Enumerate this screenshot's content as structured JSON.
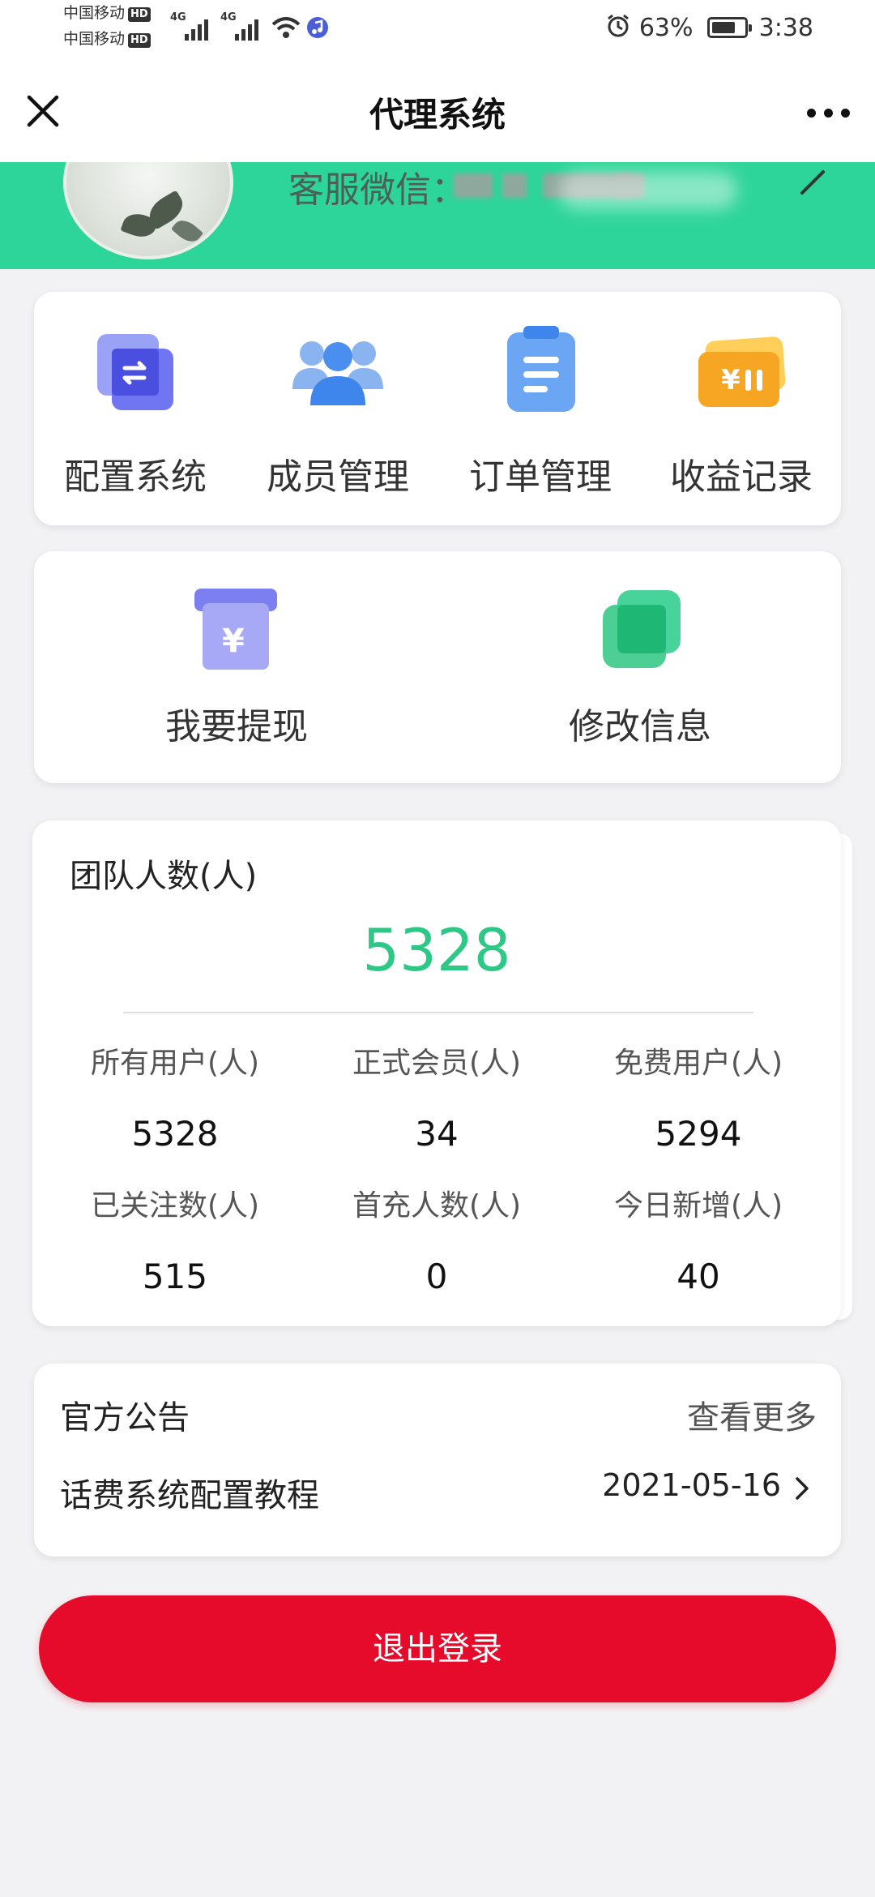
{
  "status_bar": {
    "carrier1": "中国移动",
    "carrier2": "中国移动",
    "hd": "HD",
    "net1": "4G",
    "net2": "4G",
    "battery": "63%",
    "time": "3:38"
  },
  "nav": {
    "title": "代理系统"
  },
  "header": {
    "customer_service": "客服微信："
  },
  "menu_primary": [
    {
      "label": "配置系统",
      "icon": "config-icon"
    },
    {
      "label": "成员管理",
      "icon": "members-icon"
    },
    {
      "label": "订单管理",
      "icon": "orders-icon"
    },
    {
      "label": "收益记录",
      "icon": "earnings-icon"
    }
  ],
  "menu_secondary": [
    {
      "label": "我要提现",
      "icon": "withdraw-icon"
    },
    {
      "label": "修改信息",
      "icon": "edit-info-icon"
    }
  ],
  "team": {
    "label": "团队人数(人)",
    "total": "5328",
    "stats": [
      {
        "label": "所有用户(人)",
        "value": "5328"
      },
      {
        "label": "正式会员(人)",
        "value": "34"
      },
      {
        "label": "免费用户(人)",
        "value": "5294"
      },
      {
        "label": "已关注数(人)",
        "value": "515"
      },
      {
        "label": "首充人数(人)",
        "value": "0"
      },
      {
        "label": "今日新增(人)",
        "value": "40"
      }
    ]
  },
  "notice": {
    "title": "官方公告",
    "more": "查看更多",
    "item_title": "话费系统配置教程",
    "item_date": "2021-05-16"
  },
  "logout": {
    "label": "退出登录"
  },
  "colors": {
    "brand_green": "#2ed59a",
    "total_green": "#2ec886",
    "logout_red": "#e60b2a"
  }
}
